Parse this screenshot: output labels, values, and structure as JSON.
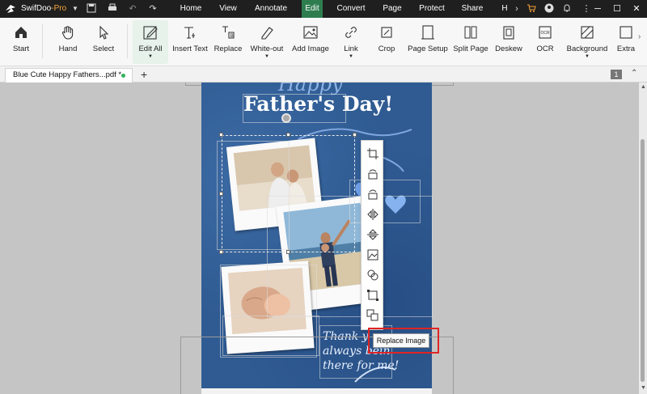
{
  "app": {
    "name": "SwifDoo",
    "name_suffix": "-Pro",
    "accent": "#2e7d4f"
  },
  "menus": [
    "Home",
    "View",
    "Annotate",
    "Edit",
    "Convert",
    "Page",
    "Protect",
    "Share",
    "H"
  ],
  "active_menu": "Edit",
  "tools": [
    {
      "label": "Start",
      "icon": "home-icon"
    },
    {
      "label": "Hand",
      "icon": "hand-icon"
    },
    {
      "label": "Select",
      "icon": "cursor-icon"
    },
    {
      "label": "Edit All",
      "icon": "edit-all-icon"
    },
    {
      "label": "Insert Text",
      "icon": "insert-text-icon"
    },
    {
      "label": "Replace",
      "icon": "replace-icon"
    },
    {
      "label": "White-out",
      "icon": "white-out-icon"
    },
    {
      "label": "Add Image",
      "icon": "add-image-icon"
    },
    {
      "label": "Link",
      "icon": "link-icon"
    },
    {
      "label": "Crop",
      "icon": "crop-icon"
    },
    {
      "label": "Page Setup",
      "icon": "page-setup-icon"
    },
    {
      "label": "Split Page",
      "icon": "split-page-icon"
    },
    {
      "label": "Deskew",
      "icon": "deskew-icon"
    },
    {
      "label": "OCR",
      "icon": "ocr-icon"
    },
    {
      "label": "Background",
      "icon": "background-icon"
    },
    {
      "label": "Extra",
      "icon": "extract-icon"
    }
  ],
  "tab": {
    "title": "Blue Cute Happy Fathers...pdf *",
    "page_number": "1"
  },
  "document": {
    "heading_script": "Happy",
    "heading": "Father's Day!",
    "message_lines": [
      "Thank y",
      "always bein",
      "there for me!"
    ]
  },
  "context_toolbar": [
    "crop-icon",
    "rotate-left-icon",
    "rotate-right-icon",
    "flip-horizontal-icon",
    "flip-vertical-icon",
    "extract-image-icon",
    "group-icon",
    "resize-icon",
    "replace-image-icon"
  ],
  "tooltip": "Replace Image"
}
